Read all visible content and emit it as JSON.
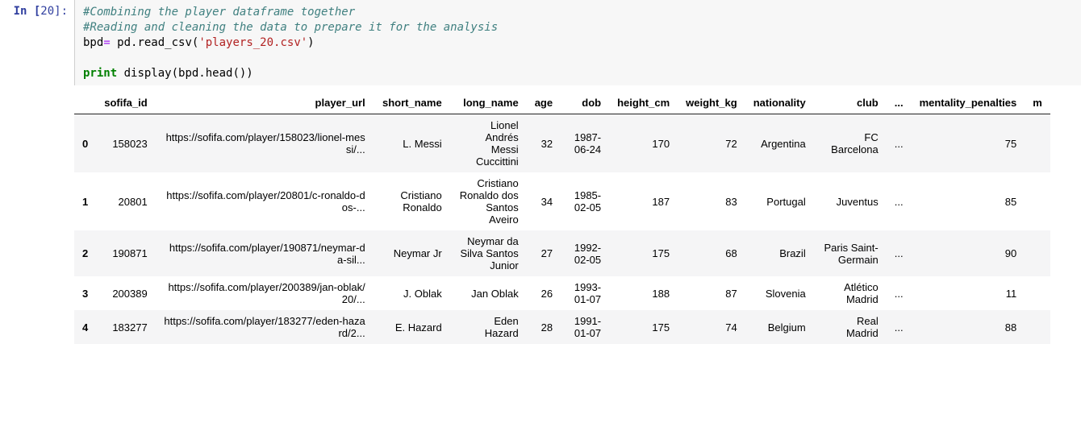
{
  "prompt": {
    "label_in": "In [",
    "number": "20",
    "label_close": "]:"
  },
  "code": {
    "line1_comment": "#Combining the player dataframe together",
    "line2_comment": "#Reading and cleaning the data to prepare it for the analysis",
    "line3_a": "bpd",
    "line3_b": "=",
    "line3_c": " pd.read_csv(",
    "line3_str": "'players_20.csv'",
    "line3_d": ")",
    "line5_kw": "print",
    "line5_rest": " display(bpd.head())"
  },
  "table": {
    "columns": [
      "sofifa_id",
      "player_url",
      "short_name",
      "long_name",
      "age",
      "dob",
      "height_cm",
      "weight_kg",
      "nationality",
      "club",
      "...",
      "mentality_penalties",
      "m"
    ],
    "rows": [
      {
        "idx": "0",
        "sofifa_id": "158023",
        "player_url": "https://sofifa.com/player/158023/lionel-messi/...",
        "short_name": "L. Messi",
        "long_name": "Lionel Andrés Messi Cuccittini",
        "age": "32",
        "dob": "1987-06-24",
        "height_cm": "170",
        "weight_kg": "72",
        "nationality": "Argentina",
        "club": "FC Barcelona",
        "ellipsis": "...",
        "mentality_penalties": "75"
      },
      {
        "idx": "1",
        "sofifa_id": "20801",
        "player_url": "https://sofifa.com/player/20801/c-ronaldo-dos-...",
        "short_name": "Cristiano Ronaldo",
        "long_name": "Cristiano Ronaldo dos Santos Aveiro",
        "age": "34",
        "dob": "1985-02-05",
        "height_cm": "187",
        "weight_kg": "83",
        "nationality": "Portugal",
        "club": "Juventus",
        "ellipsis": "...",
        "mentality_penalties": "85"
      },
      {
        "idx": "2",
        "sofifa_id": "190871",
        "player_url": "https://sofifa.com/player/190871/neymar-da-sil...",
        "short_name": "Neymar Jr",
        "long_name": "Neymar da Silva Santos Junior",
        "age": "27",
        "dob": "1992-02-05",
        "height_cm": "175",
        "weight_kg": "68",
        "nationality": "Brazil",
        "club": "Paris Saint-Germain",
        "ellipsis": "...",
        "mentality_penalties": "90"
      },
      {
        "idx": "3",
        "sofifa_id": "200389",
        "player_url": "https://sofifa.com/player/200389/jan-oblak/20/...",
        "short_name": "J. Oblak",
        "long_name": "Jan Oblak",
        "age": "26",
        "dob": "1993-01-07",
        "height_cm": "188",
        "weight_kg": "87",
        "nationality": "Slovenia",
        "club": "Atlético Madrid",
        "ellipsis": "...",
        "mentality_penalties": "11"
      },
      {
        "idx": "4",
        "sofifa_id": "183277",
        "player_url": "https://sofifa.com/player/183277/eden-hazard/2...",
        "short_name": "E. Hazard",
        "long_name": "Eden Hazard",
        "age": "28",
        "dob": "1991-01-07",
        "height_cm": "175",
        "weight_kg": "74",
        "nationality": "Belgium",
        "club": "Real Madrid",
        "ellipsis": "...",
        "mentality_penalties": "88"
      }
    ]
  }
}
